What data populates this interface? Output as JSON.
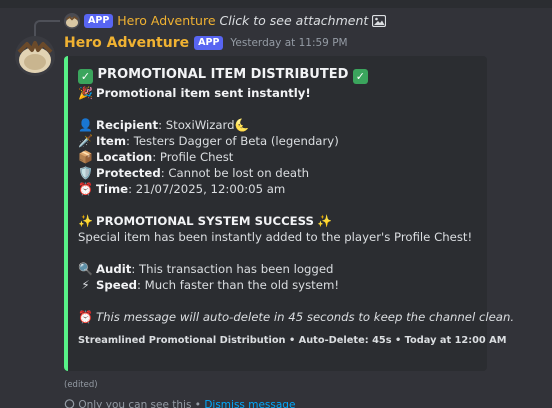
{
  "reply": {
    "author": "Hero Adventure",
    "badge": "APP",
    "text": "Click to see attachment"
  },
  "message": {
    "author": "Hero Adventure",
    "badge": "APP",
    "timestamp": "Yesterday at 11:59 PM",
    "edited": "(edited)"
  },
  "embed": {
    "accent_color": "#57f287",
    "title": "PROMOTIONAL ITEM DISTRIBUTED",
    "subtitle": "Promotional item sent instantly!",
    "fields": [
      {
        "icon": "👤",
        "label": "Recipient",
        "value": "StoxiWizard🌜"
      },
      {
        "icon": "🗡️",
        "label": "Item",
        "value": "Testers Dagger of Beta (legendary)"
      },
      {
        "icon": "📦",
        "label": "Location",
        "value": "Profile Chest"
      },
      {
        "icon": "🛡️",
        "label": "Protected",
        "value": "Cannot be lost on death"
      },
      {
        "icon": "⏰",
        "label": "Time",
        "value": "21/07/2025, 12:00:05 am"
      }
    ],
    "success_title": "PROMOTIONAL SYSTEM SUCCESS",
    "success_text": "Special item has been instantly added to the player's Profile Chest!",
    "audit_label": "Audit",
    "audit_value": "This transaction has been logged",
    "speed_label": "Speed",
    "speed_value": "Much faster than the old system!",
    "autodelete_text": "This message will auto-delete in 45 seconds to keep the channel clean.",
    "footer": "Streamlined Promotional Distribution • Auto-Delete: 45s • Today at 12:00 AM"
  },
  "ephemeral": {
    "text": "Only you can see this •",
    "link": "Dismiss message"
  }
}
